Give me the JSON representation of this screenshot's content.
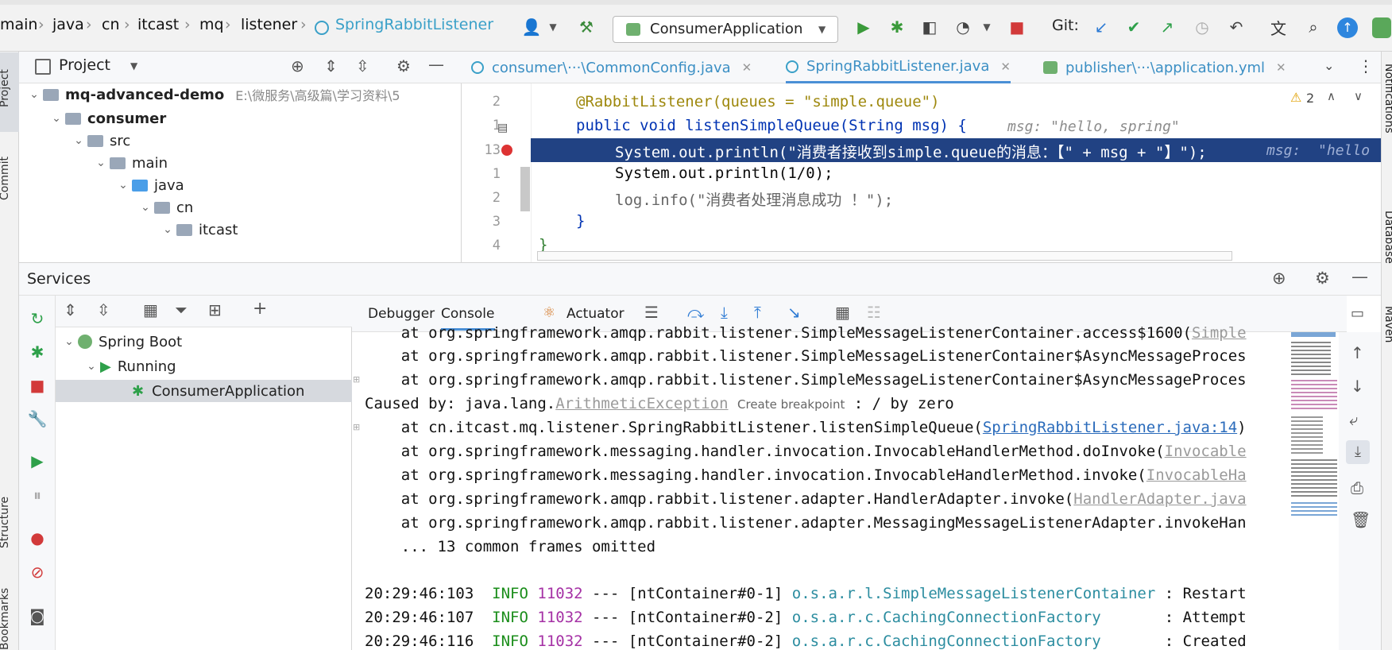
{
  "breadcrumb": [
    "main",
    "java",
    "cn",
    "itcast",
    "mq",
    "listener"
  ],
  "breadcrumb_file": "SpringRabbitListener",
  "run_config": "ConsumerApplication",
  "git_label": "Git:",
  "project_panel": {
    "title": "Project",
    "tree": [
      {
        "label": "mq-advanced-demo",
        "path": "E:\\微服务\\高级篇\\学习资料\\5",
        "bold": true
      },
      {
        "label": "consumer",
        "bold": true
      },
      {
        "label": "src"
      },
      {
        "label": "main"
      },
      {
        "label": "java"
      },
      {
        "label": "cn"
      },
      {
        "label": "itcast"
      }
    ]
  },
  "editor_tabs": [
    {
      "label": "consumer\\···\\CommonConfig.java"
    },
    {
      "label": "SpringRabbitListener.java"
    },
    {
      "label": "publisher\\···\\application.yml"
    }
  ],
  "warnings_count": "2",
  "code_lines": [
    {
      "ln": "2",
      "text": "@RabbitListener(queues = \"simple.queue\")"
    },
    {
      "ln": "1",
      "text": "public void listenSimpleQueue(String msg) {",
      "hint": "msg:  \"hello, spring\""
    },
    {
      "ln": "13",
      "text": "System.out.println(\"消费者接收到simple.queue的消息：【\" + msg + \"】\");",
      "hint": "msg:  \"hello"
    },
    {
      "ln": "1",
      "text": "System.out.println(1/0);"
    },
    {
      "ln": "2",
      "text": "log.info(\"消费者处理消息成功 ！\");"
    },
    {
      "ln": "3",
      "text": "}"
    },
    {
      "ln": "4",
      "text": "}"
    }
  ],
  "services": {
    "title": "Services",
    "tree": [
      {
        "label": "Spring Boot"
      },
      {
        "label": "Running"
      },
      {
        "label": "ConsumerApplication"
      }
    ]
  },
  "console_tabs": {
    "debugger": "Debugger",
    "console": "Console",
    "actuator": "Actuator"
  },
  "console_lines": {
    "l1": "    at org.springframework.amqp.rabbit.listener.SimpleMessageListenerContainer.access$1600(",
    "l1_link": "Simple",
    "l2": "    at org.springframework.amqp.rabbit.listener.SimpleMessageListenerContainer$AsyncMessageProces",
    "l3": "    at org.springframework.amqp.rabbit.listener.SimpleMessageListenerContainer$AsyncMessageProces",
    "l4_pre": "Caused by: java.lang.",
    "l4_exc": "ArithmeticException",
    "l4_bp": "Create breakpoint",
    "l4_post": " : / by zero",
    "l5": "    at cn.itcast.mq.listener.SpringRabbitListener.listenSimpleQueue(",
    "l5_link": "SpringRabbitListener.java:14",
    "l5_end": ")",
    "l6": "    at org.springframework.messaging.handler.invocation.InvocableHandlerMethod.doInvoke(",
    "l6_link": "Invocable",
    "l7": "    at org.springframework.messaging.handler.invocation.InvocableHandlerMethod.invoke(",
    "l7_link": "InvocableHa",
    "l8": "    at org.springframework.amqp.rabbit.listener.adapter.HandlerAdapter.invoke(",
    "l8_link": "HandlerAdapter.java",
    "l9": "    at org.springframework.amqp.rabbit.listener.adapter.MessagingMessageListenerAdapter.invokeHan",
    "l10": "    ... 13 common frames omitted",
    "logs": [
      {
        "time": "20:29:46:103",
        "level": "INFO",
        "pid": "11032",
        "sep": "---",
        "thread": "[ntContainer#0-1]",
        "cls": "o.s.a.r.l.SimpleMessageListenerContainer",
        "msg": ": Restart"
      },
      {
        "time": "20:29:46:107",
        "level": "INFO",
        "pid": "11032",
        "sep": "---",
        "thread": "[ntContainer#0-2]",
        "cls": "o.s.a.r.c.CachingConnectionFactory      ",
        "msg": ": Attempt"
      },
      {
        "time": "20:29:46:116",
        "level": "INFO",
        "pid": "11032",
        "sep": "---",
        "thread": "[ntContainer#0-2]",
        "cls": "o.s.a.r.c.CachingConnectionFactory      ",
        "msg": ": Created"
      }
    ]
  },
  "side_labels": {
    "project": "Project",
    "commit": "Commit",
    "structure": "Structure",
    "bookmarks": "Bookmarks",
    "notifications": "Notifications",
    "database": "Database",
    "maven": "Maven"
  }
}
